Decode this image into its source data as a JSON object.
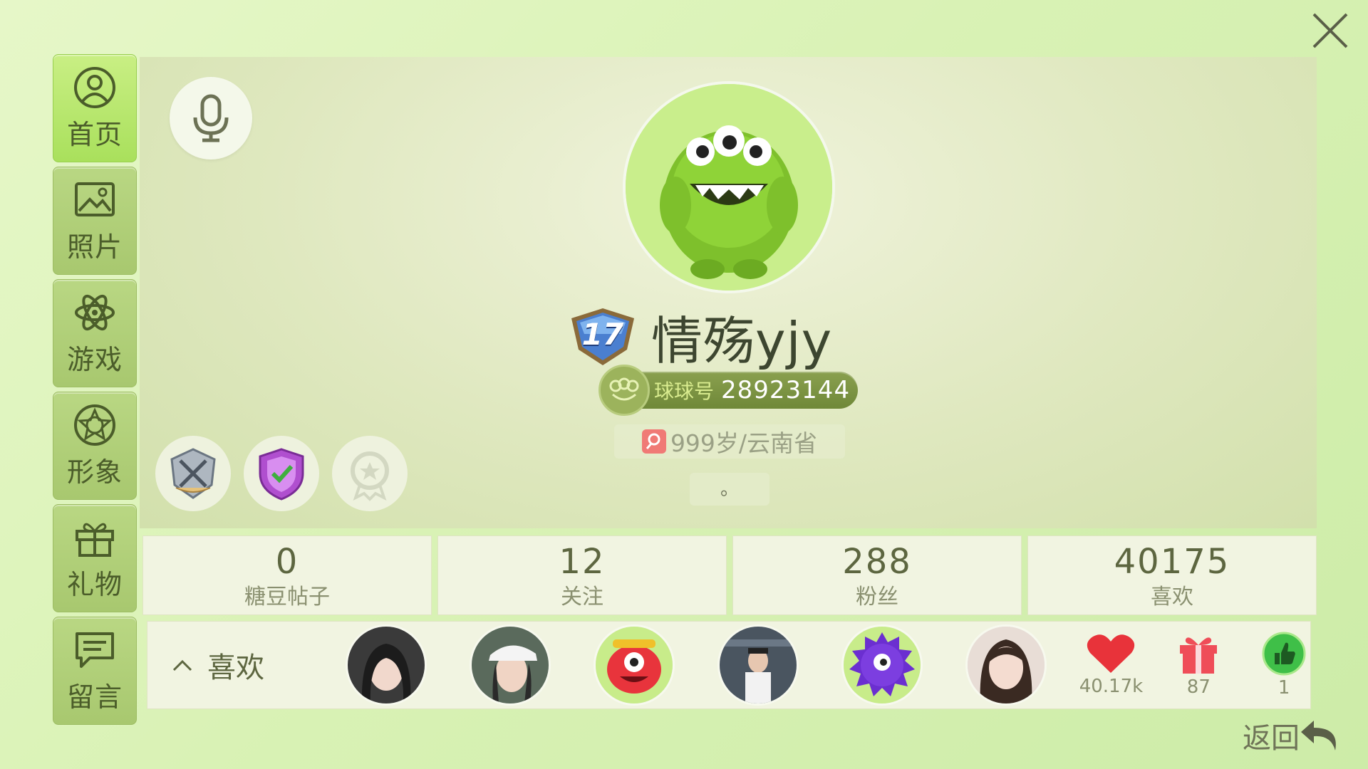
{
  "sidebar": {
    "items": [
      {
        "label": "首页",
        "icon": "profile-icon",
        "active": true
      },
      {
        "label": "照片",
        "icon": "photo-icon",
        "active": false
      },
      {
        "label": "游戏",
        "icon": "atom-icon",
        "active": false
      },
      {
        "label": "形象",
        "icon": "star-circle-icon",
        "active": false
      },
      {
        "label": "礼物",
        "icon": "gift-icon",
        "active": false
      },
      {
        "label": "留言",
        "icon": "message-icon",
        "active": false
      }
    ]
  },
  "profile": {
    "level": "17",
    "nickname": "情殇yjy",
    "id_label": "球球号",
    "id_value": "28923144",
    "info": "999岁/云南省",
    "signature": "。"
  },
  "stats": [
    {
      "value": "0",
      "label": "糖豆帖子"
    },
    {
      "value": "12",
      "label": "关注"
    },
    {
      "value": "288",
      "label": "粉丝"
    },
    {
      "value": "40175",
      "label": "喜欢"
    }
  ],
  "likes": {
    "toggle_label": "喜欢",
    "counters": [
      {
        "icon": "heart-icon",
        "value": "40.17k"
      },
      {
        "icon": "gift-box-icon",
        "value": "87"
      },
      {
        "icon": "thumbs-up-icon",
        "value": "1"
      }
    ]
  },
  "back_label": "返回",
  "colors": {
    "accent": "#a9e05c",
    "heart": "#e8333a",
    "gift": "#ef4d58",
    "thumb": "#3fbf48"
  }
}
